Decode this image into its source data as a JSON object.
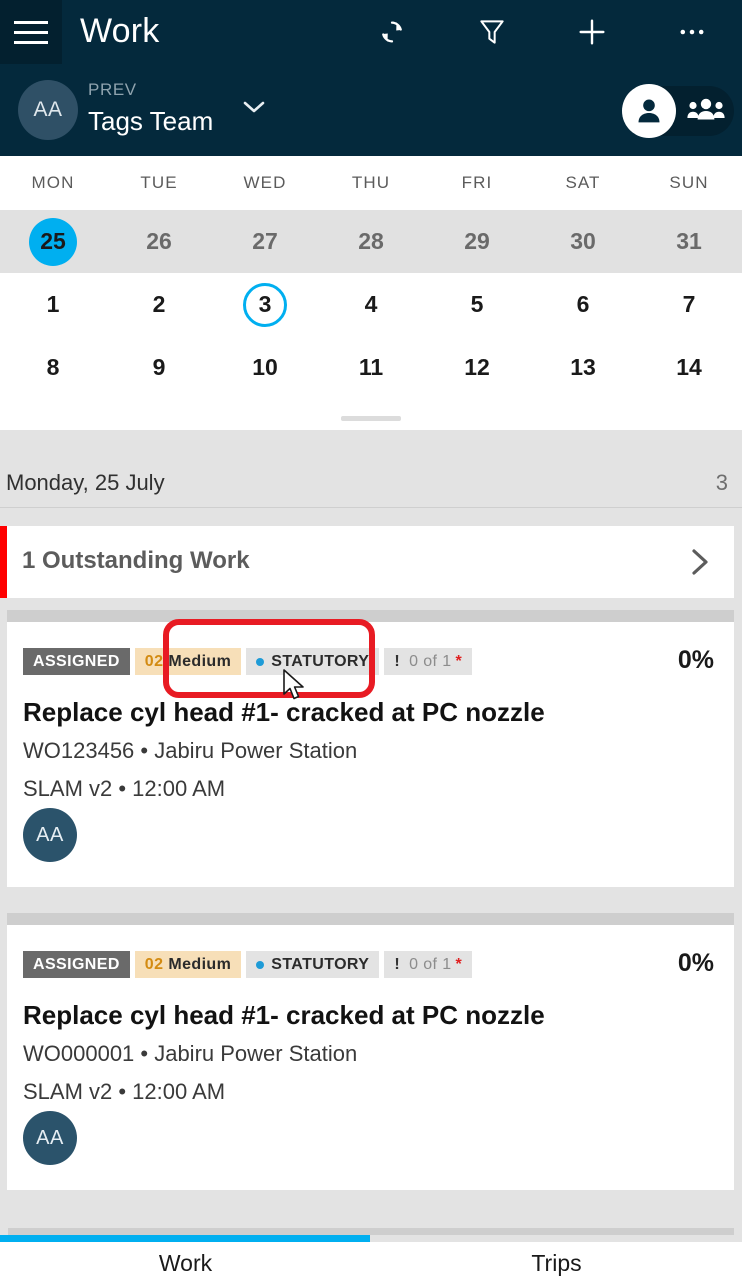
{
  "appbar": {
    "title": "Work",
    "menu_icon": "hamburger-icon",
    "actions": [
      {
        "name": "sync-icon",
        "label": "Sync"
      },
      {
        "name": "filter-icon",
        "label": "Filter"
      },
      {
        "name": "add-icon",
        "label": "Add"
      },
      {
        "name": "more-icon",
        "label": "More"
      }
    ]
  },
  "teambar": {
    "avatar_initials": "AA",
    "prev_label": "PREV",
    "team_name": "Tags Team",
    "chevron_icon": "chevron-down-icon",
    "toggle": {
      "person_icon": "person-icon",
      "group_icon": "people-group-icon",
      "selected": "person"
    }
  },
  "calendar": {
    "day_names": [
      "MON",
      "TUE",
      "WED",
      "THU",
      "FRI",
      "SAT",
      "SUN"
    ],
    "weeks": [
      {
        "shaded": true,
        "days": [
          "25",
          "26",
          "27",
          "28",
          "29",
          "30",
          "31"
        ]
      },
      {
        "shaded": false,
        "days": [
          "1",
          "2",
          "3",
          "4",
          "5",
          "6",
          "7"
        ]
      },
      {
        "shaded": false,
        "days": [
          "8",
          "9",
          "10",
          "11",
          "12",
          "13",
          "14"
        ]
      }
    ],
    "selected_day": "25",
    "today_day": "3",
    "accent_color": "#00AFF0"
  },
  "date_section": {
    "label": "Monday, 25 July",
    "count": "3"
  },
  "outstanding": {
    "label": "1 Outstanding Work",
    "accent_color": "#ff0000",
    "chevron_icon": "chevron-right-icon"
  },
  "cards": [
    {
      "status": "ASSIGNED",
      "priority_num": "02",
      "priority_label": "Medium",
      "statutory": "STATUTORY",
      "tasks": "0 of 1",
      "tasks_bang": "!",
      "tasks_star": "*",
      "percent": "0%",
      "title": "Replace cyl head #1- cracked at PC nozzle",
      "subtitle": "WO123456 • Jabiru Power Station",
      "meta": "SLAM v2 • 12:00 AM",
      "avatar_initials": "AA"
    },
    {
      "status": "ASSIGNED",
      "priority_num": "02",
      "priority_label": "Medium",
      "statutory": "STATUTORY",
      "tasks": "0 of 1",
      "tasks_bang": "!",
      "tasks_star": "*",
      "percent": "0%",
      "title": "Replace cyl head #1- cracked at PC nozzle",
      "subtitle": "WO000001 • Jabiru Power Station",
      "meta": "SLAM v2 • 12:00 AM",
      "avatar_initials": "AA"
    }
  ],
  "bottom_nav": {
    "tabs": [
      {
        "label": "Work",
        "active": true
      },
      {
        "label": "Trips",
        "active": false
      }
    ],
    "active_color": "#00AFF0"
  }
}
